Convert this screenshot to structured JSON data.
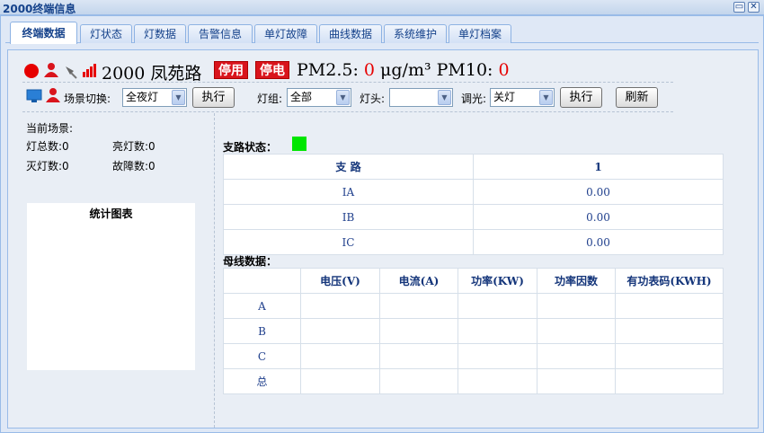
{
  "window": {
    "title": "2000终端信息",
    "restore_icon": "restore-icon",
    "close_icon": "close-icon"
  },
  "tabs": [
    "终端数据",
    "灯状态",
    "灯数据",
    "告警信息",
    "单灯故障",
    "曲线数据",
    "系统维护",
    "单灯档案"
  ],
  "active_tab": "终端数据",
  "status": {
    "terminal_name": "2000 凤苑路",
    "badge_disabled": "停用",
    "badge_power_off": "停电",
    "pm25_label": "PM2.5:",
    "pm25_value": "0",
    "unit": "μg/m³",
    "pm10_label": "PM10:",
    "pm10_value": "0",
    "icons": [
      "alarm-red-dot-icon",
      "user-icon",
      "antenna-icon",
      "signal-bars-icon"
    ],
    "signal_color": "#e60000"
  },
  "controls": {
    "scene_label": "场景切换:",
    "scene_value": "全夜灯",
    "execute1": "执行",
    "group_label": "灯组:",
    "group_value": "全部",
    "head_label": "灯头:",
    "head_value": "",
    "dim_label": "调光:",
    "dim_value": "关灯",
    "execute2": "执行",
    "refresh": "刷新"
  },
  "left": {
    "current_scene_label": "当前场景:",
    "total_lamps": "灯总数:0",
    "on_lamps": "亮灯数:0",
    "off_lamps": "灭灯数:0",
    "fault_count": "故障数:0",
    "chart_title": "统计图表"
  },
  "branch": {
    "title": "支路状态：",
    "status_color": "#00e600",
    "headers": [
      "支 路",
      "1"
    ],
    "rows": [
      [
        "IA",
        "0.00"
      ],
      [
        "IB",
        "0.00"
      ],
      [
        "IC",
        "0.00"
      ]
    ]
  },
  "bus": {
    "title": "母线数据：",
    "headers": [
      "",
      "电压(V)",
      "电流(A)",
      "功率(KW)",
      "功率因数",
      "有功表码(KWH)"
    ],
    "rows": [
      "A",
      "B",
      "C",
      "总"
    ]
  }
}
